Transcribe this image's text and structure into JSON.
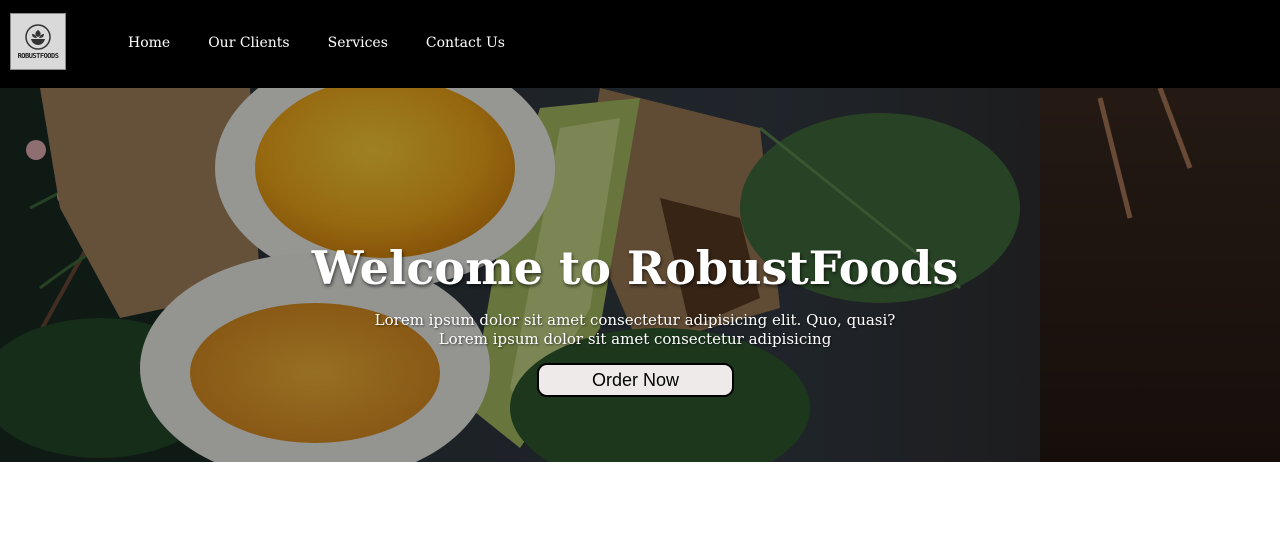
{
  "brand": {
    "logo_text": "ROBUSTFOODS",
    "logo_icon": "bowl-leaf-icon"
  },
  "nav": {
    "items": [
      {
        "label": "Home"
      },
      {
        "label": "Our Clients"
      },
      {
        "label": "Services"
      },
      {
        "label": "Contact Us"
      }
    ]
  },
  "hero": {
    "title": "Welcome to RobustFoods",
    "subtitle_line1": "Lorem ipsum dolor sit amet consectetur adipisicing elit. Quo, quasi?",
    "subtitle_line2": "Lorem ipsum dolor sit amet consectetur adipisicing",
    "cta_label": "Order Now",
    "background_image": "egg-avocado-toast-photo"
  },
  "colors": {
    "navbar_bg": "#000000",
    "nav_text": "#ffffff",
    "button_bg": "#efeaea",
    "button_border": "#000000",
    "page_bg": "#ffffff"
  }
}
